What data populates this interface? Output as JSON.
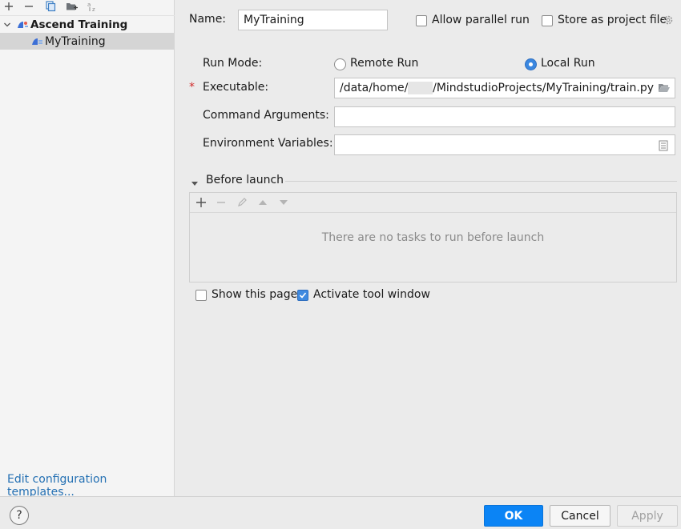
{
  "left_toolbar": {
    "icons": [
      "add-icon",
      "remove-icon",
      "copy-icon",
      "folder-add-icon",
      "sort-az-icon"
    ]
  },
  "tree": {
    "parent_label": "Ascend Training",
    "child_label": "MyTraining"
  },
  "edit_templates_link": "Edit configuration templates...",
  "form": {
    "name_label": "Name:",
    "name_value": "MyTraining",
    "allow_parallel_label": "Allow parallel run",
    "allow_parallel_checked": false,
    "store_project_label": "Store as project file",
    "store_project_checked": false,
    "run_mode_label": "Run Mode:",
    "remote_run_label": "Remote Run",
    "local_run_label": "Local Run",
    "run_mode_selected": "Local Run",
    "executable_required_mark": "*",
    "executable_label": "Executable:",
    "executable_prefix": "/data/home/",
    "executable_suffix": "/MindstudioProjects/MyTraining/train.py",
    "command_args_label": "Command Arguments:",
    "command_args_value": "",
    "env_vars_label": "Environment Variables:",
    "env_vars_value": ""
  },
  "before_launch": {
    "title": "Before launch",
    "empty_text": "There are no tasks to run before launch",
    "toolbar_icons": [
      "add-icon",
      "remove-icon",
      "edit-icon",
      "move-up-icon",
      "move-down-icon"
    ]
  },
  "options": {
    "show_page_label": "Show this page",
    "show_page_checked": false,
    "activate_tool_label": "Activate tool window",
    "activate_tool_checked": true
  },
  "buttons": {
    "ok": "OK",
    "cancel": "Cancel",
    "apply": "Apply",
    "help": "?"
  },
  "colors": {
    "accent": "#0b84f5",
    "link": "#2470b3",
    "required": "#d12b2b"
  }
}
